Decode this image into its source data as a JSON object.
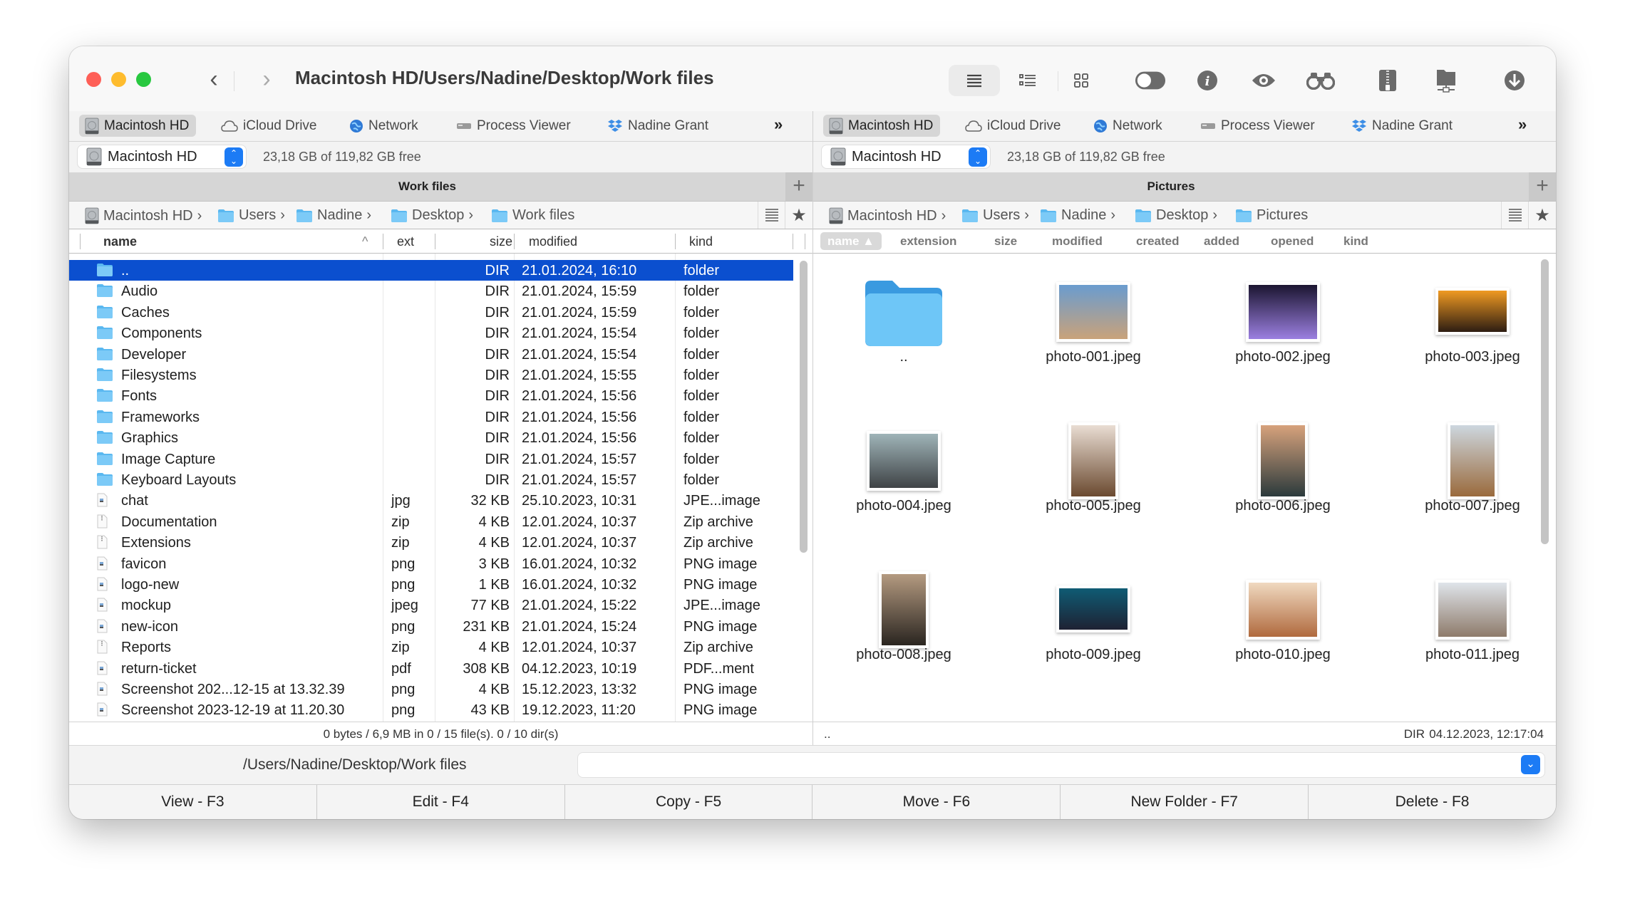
{
  "window": {
    "title": "Macintosh HD/Users/Nadine/Desktop/Work files",
    "toolbar_icons": [
      "list-view-icon",
      "detail-list-icon",
      "grid-view-icon",
      "toggle-icon",
      "info-icon",
      "eye-icon",
      "binoculars-icon",
      "zip-icon",
      "network-folder-icon",
      "download-icon"
    ]
  },
  "tabs": {
    "left": [
      {
        "label": "Macintosh HD",
        "icon": "hard-drive-icon",
        "active": true
      },
      {
        "label": "iCloud Drive",
        "icon": "cloud-icon"
      },
      {
        "label": "Network",
        "icon": "globe-icon"
      },
      {
        "label": "Process Viewer",
        "icon": "process-viewer-icon"
      },
      {
        "label": "Nadine Grant",
        "icon": "dropbox-icon"
      }
    ],
    "right": [
      {
        "label": "Macintosh HD",
        "icon": "hard-drive-icon",
        "active": true
      },
      {
        "label": "iCloud Drive",
        "icon": "cloud-icon"
      },
      {
        "label": "Network",
        "icon": "globe-icon"
      },
      {
        "label": "Process Viewer",
        "icon": "process-viewer-icon"
      },
      {
        "label": "Nadine Grant",
        "icon": "dropbox-icon"
      }
    ],
    "more_label": "»"
  },
  "left_panel": {
    "drive": "Macintosh HD",
    "free_space": "23,18 GB of 119,82 GB free",
    "header_title": "Work files",
    "breadcrumb": [
      "Macintosh HD",
      "Users",
      "Nadine",
      "Desktop",
      "Work files"
    ],
    "columns": {
      "name": "name",
      "ext": "ext",
      "size": "size",
      "modified": "modified",
      "kind": "kind",
      "sort_indicator": "^"
    },
    "rows": [
      {
        "name": "..",
        "ext": "",
        "size": "DIR",
        "modified": "21.01.2024, 16:10",
        "kind": "folder",
        "type": "folder",
        "selected": true
      },
      {
        "name": "Audio",
        "ext": "",
        "size": "DIR",
        "modified": "21.01.2024, 15:59",
        "kind": "folder",
        "type": "folder"
      },
      {
        "name": "Caches",
        "ext": "",
        "size": "DIR",
        "modified": "21.01.2024, 15:59",
        "kind": "folder",
        "type": "folder"
      },
      {
        "name": "Components",
        "ext": "",
        "size": "DIR",
        "modified": "21.01.2024, 15:54",
        "kind": "folder",
        "type": "folder"
      },
      {
        "name": "Developer",
        "ext": "",
        "size": "DIR",
        "modified": "21.01.2024, 15:54",
        "kind": "folder",
        "type": "folder"
      },
      {
        "name": "Filesystems",
        "ext": "",
        "size": "DIR",
        "modified": "21.01.2024, 15:55",
        "kind": "folder",
        "type": "folder"
      },
      {
        "name": "Fonts",
        "ext": "",
        "size": "DIR",
        "modified": "21.01.2024, 15:56",
        "kind": "folder",
        "type": "folder"
      },
      {
        "name": "Frameworks",
        "ext": "",
        "size": "DIR",
        "modified": "21.01.2024, 15:56",
        "kind": "folder",
        "type": "folder"
      },
      {
        "name": "Graphics",
        "ext": "",
        "size": "DIR",
        "modified": "21.01.2024, 15:56",
        "kind": "folder",
        "type": "folder"
      },
      {
        "name": "Image Capture",
        "ext": "",
        "size": "DIR",
        "modified": "21.01.2024, 15:57",
        "kind": "folder",
        "type": "folder"
      },
      {
        "name": "Keyboard Layouts",
        "ext": "",
        "size": "DIR",
        "modified": "21.01.2024, 15:57",
        "kind": "folder",
        "type": "folder"
      },
      {
        "name": "chat",
        "ext": "jpg",
        "size": "32 KB",
        "modified": "25.10.2023, 10:31",
        "kind": "JPE...image",
        "type": "image"
      },
      {
        "name": "Documentation",
        "ext": "zip",
        "size": "4 KB",
        "modified": "12.01.2024, 10:37",
        "kind": "Zip archive",
        "type": "zip"
      },
      {
        "name": "Extensions",
        "ext": "zip",
        "size": "4 KB",
        "modified": "12.01.2024, 10:37",
        "kind": "Zip archive",
        "type": "zip"
      },
      {
        "name": "favicon",
        "ext": "png",
        "size": "3 KB",
        "modified": "16.01.2024, 10:32",
        "kind": "PNG image",
        "type": "image"
      },
      {
        "name": "logo-new",
        "ext": "png",
        "size": "1 KB",
        "modified": "16.01.2024, 10:32",
        "kind": "PNG image",
        "type": "image"
      },
      {
        "name": "mockup",
        "ext": "jpeg",
        "size": "77 KB",
        "modified": "21.01.2024, 15:22",
        "kind": "JPE...image",
        "type": "image"
      },
      {
        "name": "new-icon",
        "ext": "png",
        "size": "231 KB",
        "modified": "21.01.2024, 15:24",
        "kind": "PNG image",
        "type": "image"
      },
      {
        "name": "Reports",
        "ext": "zip",
        "size": "4 KB",
        "modified": "12.01.2024, 10:37",
        "kind": "Zip archive",
        "type": "zip"
      },
      {
        "name": "return-ticket",
        "ext": "pdf",
        "size": "308 KB",
        "modified": "04.12.2023, 10:19",
        "kind": "PDF...ment",
        "type": "image"
      },
      {
        "name": "Screenshot 202...12-15 at 13.32.39",
        "ext": "png",
        "size": "4 KB",
        "modified": "15.12.2023, 13:32",
        "kind": "PNG image",
        "type": "image"
      },
      {
        "name": "Screenshot 2023-12-19 at 11.20.30",
        "ext": "png",
        "size": "43 KB",
        "modified": "19.12.2023, 11:20",
        "kind": "PNG image",
        "type": "image"
      }
    ],
    "status": "0 bytes / 6,9 MB in 0 / 15 file(s). 0 / 10 dir(s)"
  },
  "right_panel": {
    "drive": "Macintosh HD",
    "free_space": "23,18 GB of 119,82 GB free",
    "header_title": "Pictures",
    "breadcrumb": [
      "Macintosh HD",
      "Users",
      "Nadine",
      "Desktop",
      "Pictures"
    ],
    "sort_columns": [
      "name ▲",
      "extension",
      "size",
      "modified",
      "created",
      "added",
      "opened",
      "kind"
    ],
    "items": [
      {
        "name": "..",
        "kind": "folder"
      },
      {
        "name": "photo-001.jpeg",
        "shape": "square",
        "colors": [
          "#6a9ccf",
          "#c9a27a"
        ]
      },
      {
        "name": "photo-002.jpeg",
        "shape": "square",
        "colors": [
          "#1b1530",
          "#9b7fe0"
        ]
      },
      {
        "name": "photo-003.jpeg",
        "shape": "wide",
        "colors": [
          "#f09a22",
          "#2d1d12"
        ]
      },
      {
        "name": "photo-004.jpeg",
        "shape": "square",
        "colors": [
          "#9fb4b8",
          "#3f4346"
        ]
      },
      {
        "name": "photo-005.jpeg",
        "shape": "tall",
        "colors": [
          "#e9ddd3",
          "#6b4a30"
        ]
      },
      {
        "name": "photo-006.jpeg",
        "shape": "tall",
        "colors": [
          "#d7a27c",
          "#2b3a3c"
        ]
      },
      {
        "name": "photo-007.jpeg",
        "shape": "tall",
        "colors": [
          "#cdd7df",
          "#9a6a3c"
        ]
      },
      {
        "name": "photo-008.jpeg",
        "shape": "tall",
        "colors": [
          "#b49a80",
          "#2a2520"
        ]
      },
      {
        "name": "photo-009.jpeg",
        "shape": "wide",
        "colors": [
          "#0f5c74",
          "#1e2233"
        ]
      },
      {
        "name": "photo-010.jpeg",
        "shape": "square",
        "colors": [
          "#f0d9c0",
          "#b06a3e"
        ]
      },
      {
        "name": "photo-011.jpeg",
        "shape": "square",
        "colors": [
          "#dfe4ea",
          "#8e7b6b"
        ]
      }
    ],
    "status_left": "..",
    "status_right_kind": "DIR",
    "status_right_date": "04.12.2023, 12:17:04"
  },
  "command": {
    "path": "/Users/Nadine/Desktop/Work files",
    "input_value": ""
  },
  "function_keys": [
    "View - F3",
    "Edit - F4",
    "Copy - F5",
    "Move - F6",
    "New Folder - F7",
    "Delete - F8"
  ],
  "colors": {
    "selection": "#0b4fcf",
    "accent": "#1c7bf5",
    "folder": "#5ab8f0"
  }
}
